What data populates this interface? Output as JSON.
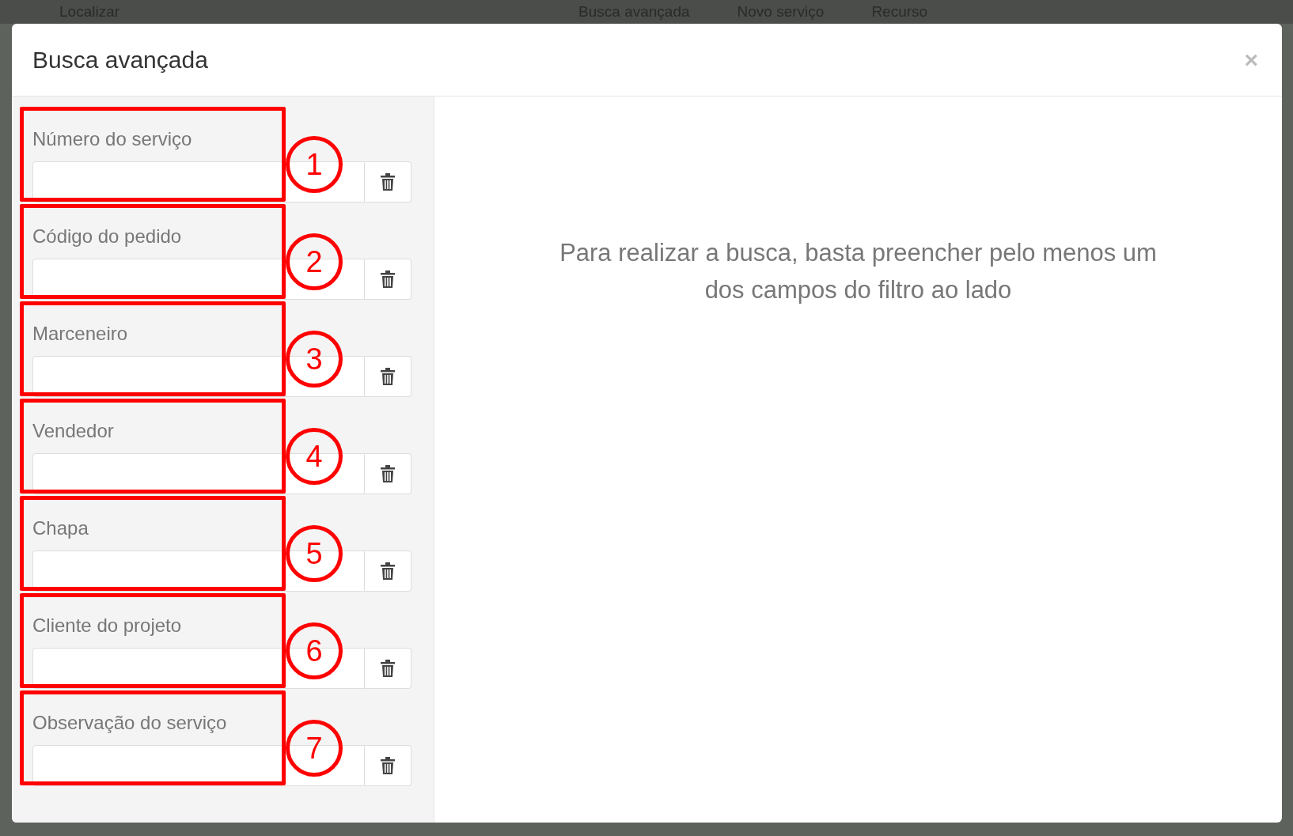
{
  "background": {
    "items": [
      "Localizar",
      "Busca avançada",
      "Novo serviço",
      "Recurso"
    ]
  },
  "modal": {
    "title": "Busca avançada",
    "close": "×",
    "fields": [
      {
        "label": "Número do serviço",
        "marker": "1"
      },
      {
        "label": "Código do pedido",
        "marker": "2"
      },
      {
        "label": "Marceneiro",
        "marker": "3"
      },
      {
        "label": "Vendedor",
        "marker": "4"
      },
      {
        "label": "Chapa",
        "marker": "5"
      },
      {
        "label": "Cliente do projeto",
        "marker": "6"
      },
      {
        "label": "Observação do serviço",
        "marker": "7"
      }
    ],
    "message": "Para realizar a busca, basta preencher pelo menos um dos campos do filtro ao lado"
  }
}
